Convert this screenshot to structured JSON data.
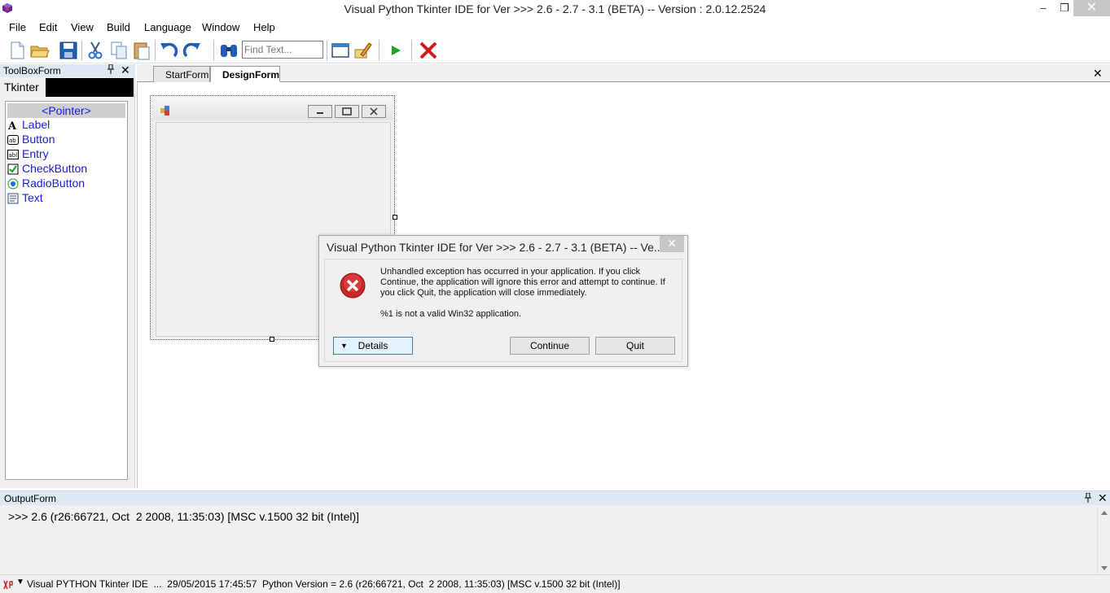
{
  "window": {
    "title": "Visual Python Tkinter IDE for Ver >>> 2.6 - 2.7 - 3.1 (BETA) -- Version : 2.0.12.2524",
    "minimize_label": "‒",
    "maximize_label": "❐",
    "close_label": "✕"
  },
  "menu": [
    "File",
    "Edit",
    "View",
    "Build",
    "Language",
    "Window",
    "Help"
  ],
  "toolbar": {
    "find_placeholder": "Find Text..."
  },
  "toolbox": {
    "title": "ToolBoxForm",
    "pin_label": "📌",
    "close_label": "✕",
    "tab_label": "Tkinter",
    "pointer_label": "<Pointer>",
    "items": [
      "Label",
      "Button",
      "Entry",
      "CheckButton",
      "RadioButton",
      "Text"
    ]
  },
  "tabs": {
    "start": "StartForm",
    "design": "DesignForm",
    "close_label": "✕"
  },
  "dialog": {
    "title": "Visual Python Tkinter IDE for Ver >>> 2.6 - 2.7 - 3.1 (BETA) -- Ve...",
    "close_label": "✕",
    "message": "Unhandled exception has occurred in your application. If you click Continue, the application will ignore this error and attempt to continue. If you click Quit, the application will close immediately.",
    "error": "%1 is not a valid Win32 application.",
    "details_label": "Details",
    "continue_label": "Continue",
    "quit_label": "Quit"
  },
  "output": {
    "title": "OutputForm",
    "pin_label": "📌",
    "close_label": "✕",
    "text": ">>> 2.6 (r26:66721, Oct  2 2008, 11:35:03) [MSC v.1500 32 bit (Intel)]"
  },
  "statusbar": {
    "text": "Visual PYTHON Tkinter IDE  ...  29/05/2015 17:45:57  Python Version = 2.6 (r26:66721, Oct  2 2008, 11:35:03) [MSC v.1500 32 bit (Intel)]"
  },
  "colors": {
    "panel_header": "#dde8f3",
    "tool_text": "#1a1adb",
    "close_red": "#d11b1b"
  }
}
